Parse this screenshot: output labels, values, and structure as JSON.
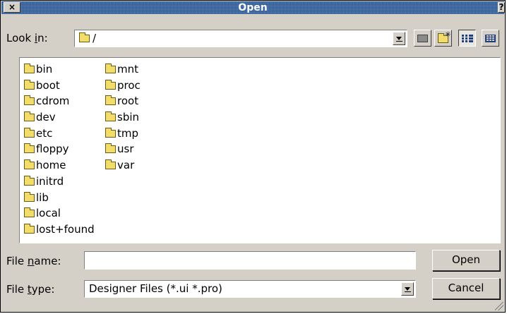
{
  "window": {
    "title": "Open",
    "close_glyph": "×",
    "help_glyph": "?"
  },
  "look_in": {
    "label_pre": "Look ",
    "label_key": "i",
    "label_post": "n:",
    "value": "/"
  },
  "toolbar": {
    "buttons": [
      "parent-directory-icon",
      "new-folder-icon",
      "list-view-icon",
      "detail-view-icon"
    ]
  },
  "files": {
    "column1": [
      "bin",
      "boot",
      "cdrom",
      "dev",
      "etc",
      "floppy",
      "home",
      "initrd",
      "lib",
      "local",
      "lost+found"
    ],
    "column2": [
      "mnt",
      "proc",
      "root",
      "sbin",
      "tmp",
      "usr",
      "var"
    ]
  },
  "file_name": {
    "label_pre": "File ",
    "label_key": "n",
    "label_post": "ame:",
    "value": ""
  },
  "file_type": {
    "label_pre": "File ",
    "label_key": "t",
    "label_post": "ype:",
    "value": "Designer Files (*.ui *.pro)"
  },
  "buttons": {
    "open": "Open",
    "cancel": "Cancel"
  },
  "colors": {
    "titlebar": "#1f4f8f",
    "folder": "#f2dc6a",
    "dialog": "#d4d0c8"
  }
}
